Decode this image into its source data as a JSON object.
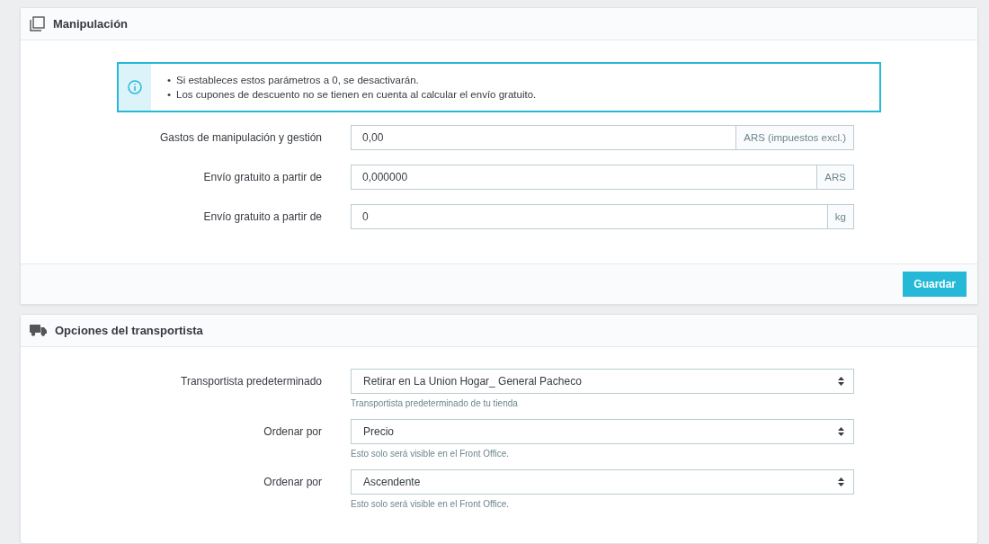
{
  "handling_panel": {
    "title": "Manipulación",
    "alert": [
      {
        "bullet": "•",
        "text": "Si estableces estos parámetros a 0, se desactivarán."
      },
      {
        "bullet": "•",
        "text": "Los cupones de descuento no se tienen en cuenta al calcular el envío gratuito."
      }
    ],
    "fields": [
      {
        "label": "Gastos de manipulación y gestión",
        "value": "0,00",
        "addon": "ARS (impuestos excl.)"
      },
      {
        "label": "Envío gratuito a partir de",
        "value": "0,000000",
        "addon": "ARS"
      },
      {
        "label": "Envío gratuito a partir de",
        "value": "0",
        "addon": "kg"
      }
    ],
    "save_button": "Guardar"
  },
  "carrier_panel": {
    "title": "Opciones del transportista",
    "selects": [
      {
        "label": "Transportista predeterminado",
        "value": "Retirar en La Union Hogar_ General Pacheco",
        "help": "Transportista predeterminado de tu tienda"
      },
      {
        "label": "Ordenar por",
        "value": "Precio",
        "help": "Esto solo será visible en el Front Office."
      },
      {
        "label": "Ordenar por",
        "value": "Ascendente",
        "help": "Esto solo será visible en el Front Office."
      }
    ]
  }
}
